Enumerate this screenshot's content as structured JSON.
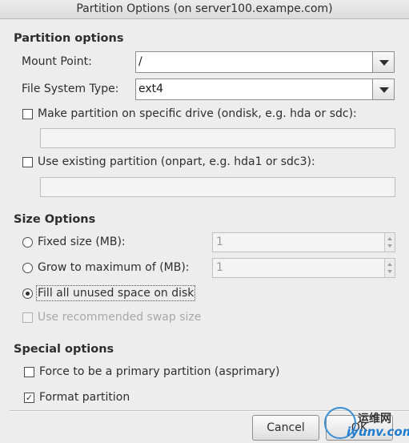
{
  "window": {
    "title": "Partition Options (on server100.exampe.com)"
  },
  "partition_options": {
    "heading": "Partition options",
    "mount_point_label": "Mount Point:",
    "mount_point_value": "/",
    "fs_type_label": "File System Type:",
    "fs_type_value": "ext4",
    "ondisk_label": "Make partition on specific drive (ondisk, e.g. hda or sdc):",
    "ondisk_checked": false,
    "onpart_label": "Use existing partition (onpart, e.g. hda1 or sdc3):",
    "onpart_checked": false
  },
  "size_options": {
    "heading": "Size Options",
    "fixed_label": "Fixed size (MB):",
    "fixed_value": "1",
    "grow_label": "Grow to maximum of (MB):",
    "grow_value": "1",
    "fill_label": "Fill all unused space on disk",
    "selected": "fill",
    "swap_label": "Use recommended swap size",
    "swap_enabled": false
  },
  "special_options": {
    "heading": "Special options",
    "primary_label": "Force to be a primary partition (asprimary)",
    "primary_checked": false,
    "format_label": "Format partition",
    "format_checked": true
  },
  "buttons": {
    "cancel": "Cancel",
    "ok": "OK"
  },
  "watermark": {
    "line1": "运维网",
    "line2": "iyunv.com"
  },
  "colors": {
    "background": "#ededed",
    "watermark_blue": "#1f7ccf"
  }
}
